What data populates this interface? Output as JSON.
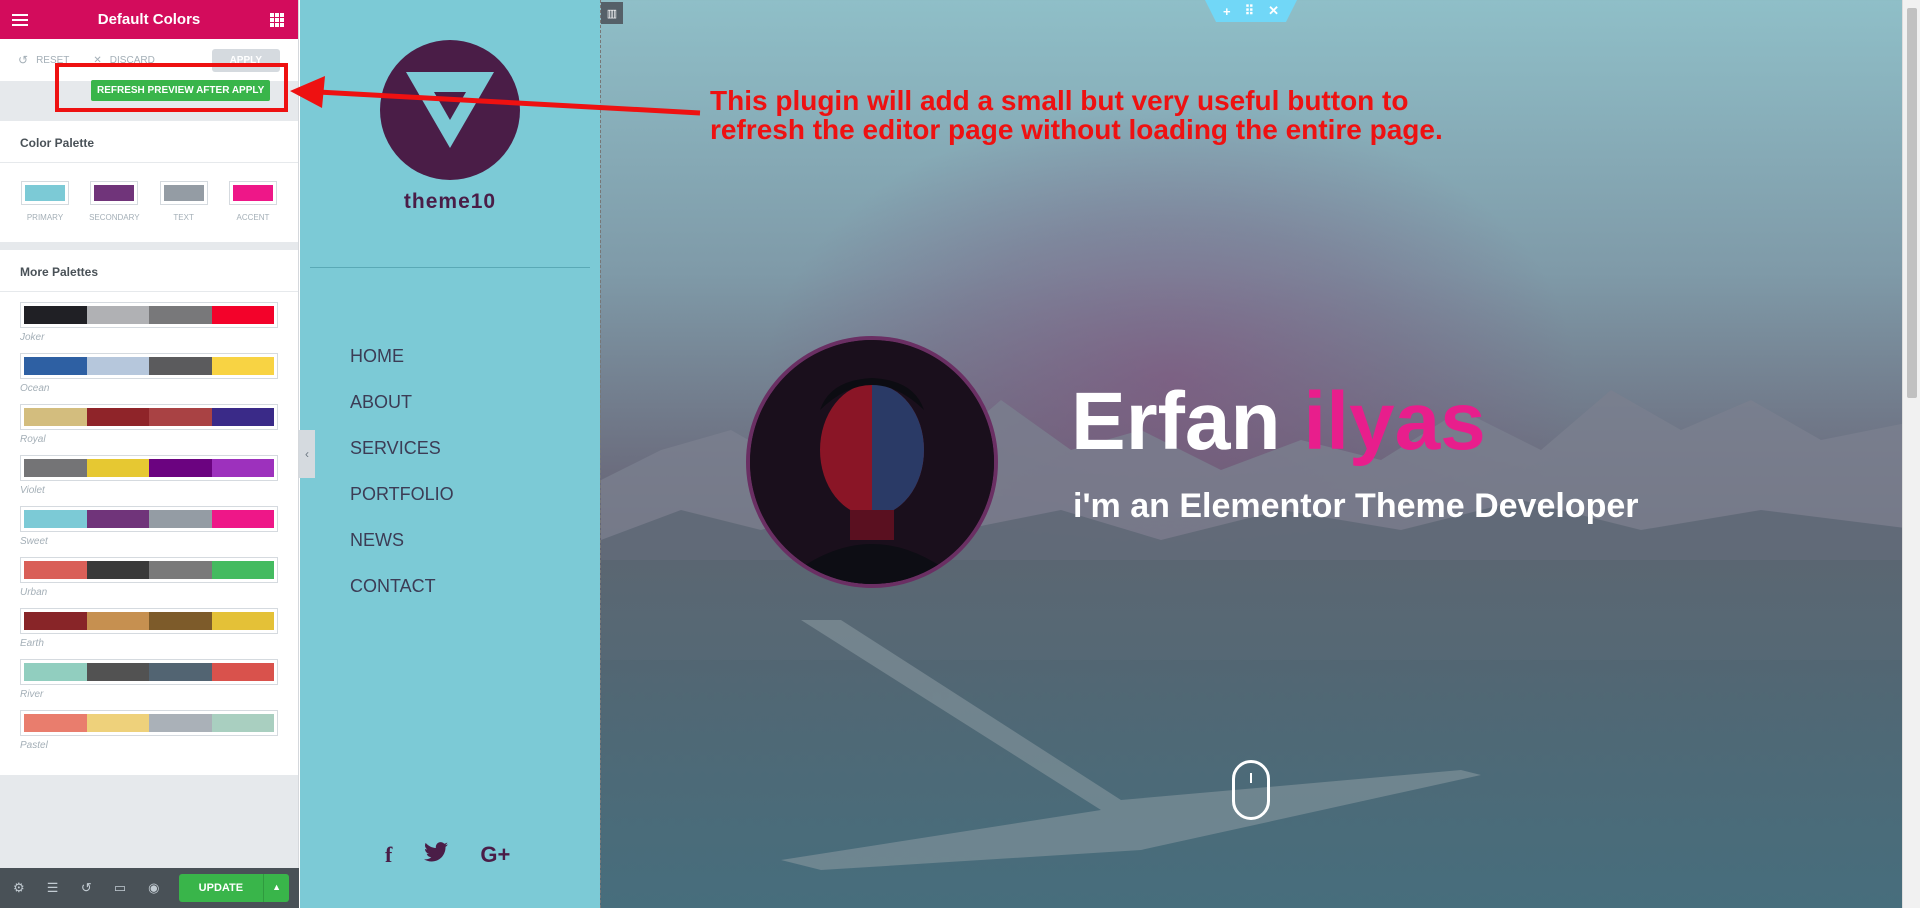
{
  "panel": {
    "title": "Default Colors",
    "toolbar": {
      "reset": "Reset",
      "discard": "Discard",
      "apply": "Apply"
    },
    "refresh_button": "Refresh preview after apply",
    "color_palette": {
      "title": "Color Palette",
      "swatches": [
        {
          "label": "Primary",
          "color": "#7ccad6"
        },
        {
          "label": "Secondary",
          "color": "#70347a"
        },
        {
          "label": "Text",
          "color": "#949ca4"
        },
        {
          "label": "Accent",
          "color": "#ee1788"
        }
      ]
    },
    "more_palettes": {
      "title": "More Palettes",
      "items": [
        {
          "name": "Joker",
          "colors": [
            "#202025",
            "#b0b1b4",
            "#78787a",
            "#f3022a"
          ]
        },
        {
          "name": "Ocean",
          "colors": [
            "#2e60a3",
            "#b6c7dc",
            "#5b5b5d",
            "#f8d343"
          ]
        },
        {
          "name": "Royal",
          "colors": [
            "#d3bd7e",
            "#8f2429",
            "#a94244",
            "#3a2a88"
          ]
        },
        {
          "name": "Violet",
          "colors": [
            "#747476",
            "#e6c832",
            "#6b0380",
            "#9d31bd"
          ]
        },
        {
          "name": "Sweet",
          "colors": [
            "#7ccad6",
            "#70347a",
            "#949ca4",
            "#ee1788"
          ]
        },
        {
          "name": "Urban",
          "colors": [
            "#d95f58",
            "#3a3a3a",
            "#7a7a7a",
            "#44bb60"
          ]
        },
        {
          "name": "Earth",
          "colors": [
            "#882528",
            "#c69050",
            "#7d5b2a",
            "#e4c137"
          ]
        },
        {
          "name": "River",
          "colors": [
            "#91cebf",
            "#525252",
            "#526472",
            "#d9524c"
          ]
        },
        {
          "name": "Pastel",
          "colors": [
            "#e97d6d",
            "#eed17b",
            "#aab1b8",
            "#a9cfc0"
          ]
        }
      ]
    },
    "footer": {
      "update": "Update"
    }
  },
  "site": {
    "name": "theme10",
    "nav": [
      "HOME",
      "ABOUT",
      "SERVICES",
      "PORTFOLIO",
      "NEWS",
      "CONTACT"
    ],
    "social": {
      "facebook": "f",
      "twitter": "🐦",
      "googleplus": "G+"
    }
  },
  "hero": {
    "first_name": "Erfan",
    "last_name": "ilyas",
    "tagline": "i'm an Elementor Theme Developer"
  },
  "annotation": {
    "line1": "This plugin will add a small but very useful button to",
    "line2": "refresh the editor page without loading the entire page."
  },
  "colors": {
    "brand": "#d30c5c",
    "update": "#39b54a",
    "annotation": "#ee1111",
    "sidebar": "#7ccad6",
    "logo": "#4a1d47",
    "accent": "#e81e8c"
  }
}
